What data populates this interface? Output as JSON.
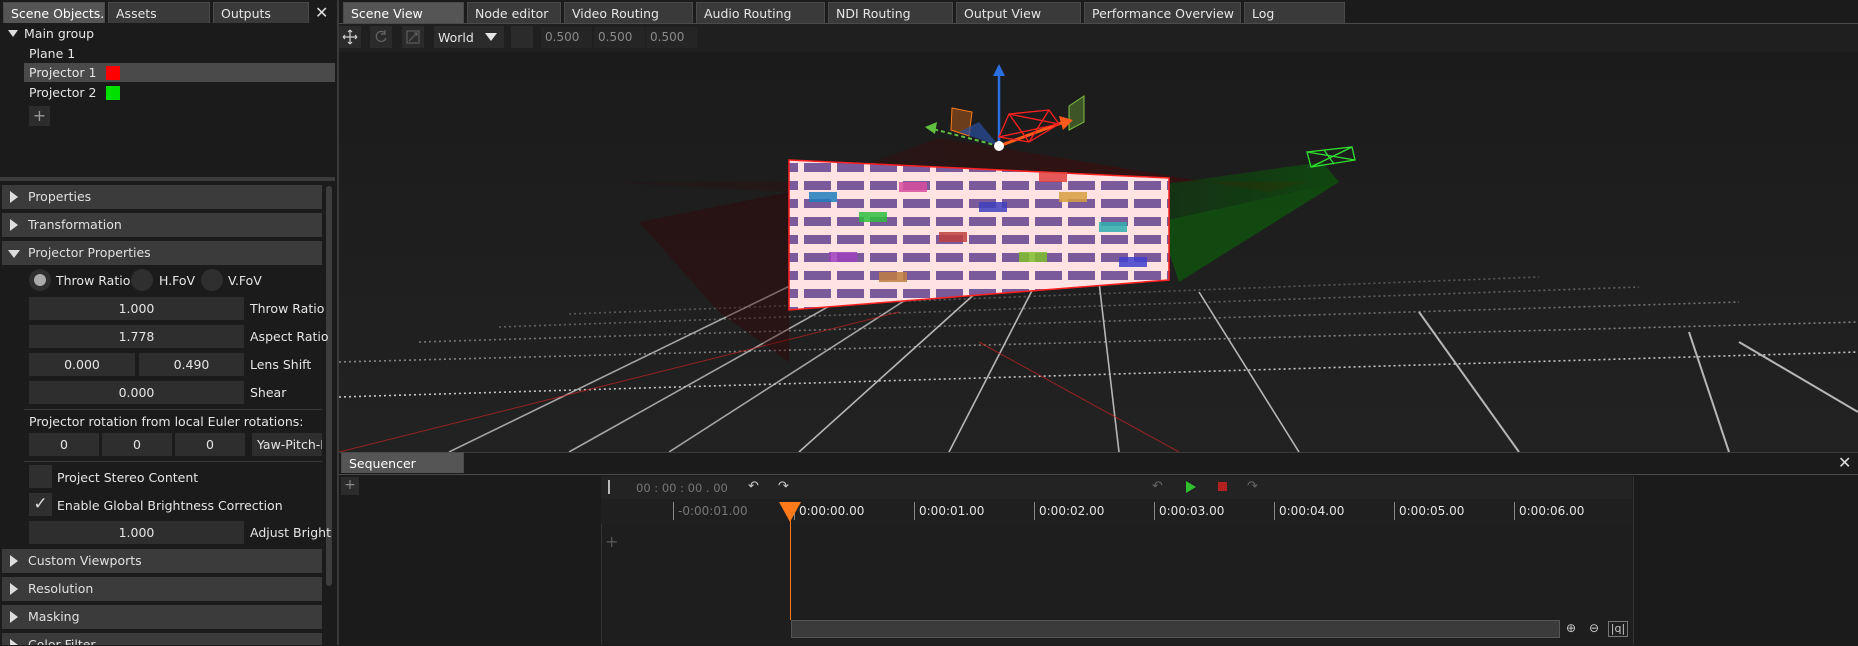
{
  "left_tabs": [
    "Scene Objects...",
    "Assets",
    "Outputs"
  ],
  "main_tabs": [
    "Scene View",
    "Node editor",
    "Video Routing",
    "Audio Routing",
    "NDI Routing",
    "Output View",
    "Performance Overview",
    "Log"
  ],
  "close_glyph": "✕",
  "scene_tree": {
    "group": "Main group",
    "items": [
      {
        "label": "Plane 1",
        "color": null
      },
      {
        "label": "Projector 1",
        "color": "#ff0000"
      },
      {
        "label": "Projector 2",
        "color": "#00e000"
      }
    ],
    "add_glyph": "+"
  },
  "sections": {
    "properties": "Properties",
    "transformation": "Transformation",
    "projector_properties": "Projector Properties",
    "custom_viewports": "Custom Viewports",
    "resolution": "Resolution",
    "masking": "Masking",
    "color_filter": "Color Filter"
  },
  "projector": {
    "radio_throw": "Throw Ratio",
    "radio_hfov": "H.FoV",
    "radio_vfov": "V.FoV",
    "throw_ratio_value": "1.000",
    "throw_ratio_label": "Throw Ratio",
    "aspect_value": "1.778",
    "aspect_label": "Aspect Ratio",
    "lens_x": "0.000",
    "lens_y": "0.490",
    "lens_label": "Lens Shift",
    "shear_value": "0.000",
    "shear_label": "Shear",
    "rotation_caption": "Projector rotation from local Euler rotations:",
    "rot_values": [
      "0",
      "0",
      "0"
    ],
    "rot_mode": "Yaw-Pitch-R",
    "stereo_label": "Project Stereo Content",
    "brightness_label": "Enable Global Brightness Correction",
    "check_glyph": "✓",
    "brightness_value": "1.000",
    "brightness_adjust_label": "Adjust Bright"
  },
  "toolbar": {
    "space": "World",
    "values": [
      "0.500",
      "0.500",
      "0.500"
    ]
  },
  "sequencer": {
    "tab": "Sequencer",
    "timecode": "00 : 00 : 00 . 00",
    "ticks": [
      "-0:00:01.00",
      "0:00:00.00",
      "0:00:01.00",
      "0:00:02.00",
      "0:00:03.00",
      "0:00:04.00",
      "0:00:05.00",
      "0:00:06.00"
    ]
  },
  "colors": {
    "accent_orange": "#ff7a1a",
    "play_green": "#2fbf2f",
    "stop_red": "#b32020"
  }
}
